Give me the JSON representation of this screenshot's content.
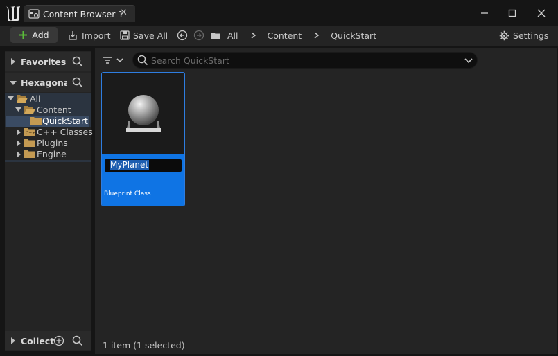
{
  "window": {
    "tab_title": "Content Browser 1",
    "tab_icon": "content-browser-icon",
    "logo_icon": "unreal-engine-logo",
    "controls": [
      "minimize-icon",
      "maximize-icon",
      "close-icon"
    ]
  },
  "toolbar": {
    "add_label": "Add",
    "import_label": "Import",
    "save_all_label": "Save All",
    "breadcrumb": [
      "All",
      "Content",
      "QuickStart"
    ],
    "settings_label": "Settings"
  },
  "sidebar": {
    "favorites_title": "Favorites",
    "project_title": "HexagonalS",
    "tree": [
      {
        "label": "All",
        "level": 0,
        "expanded": true
      },
      {
        "label": "Content",
        "level": 1,
        "expanded": true
      },
      {
        "label": "QuickStart",
        "level": 2,
        "selected": true
      },
      {
        "label": "C++ Classes",
        "level": 1,
        "expanded": false
      },
      {
        "label": "Plugins",
        "level": 1,
        "expanded": false
      },
      {
        "label": "Engine",
        "level": 1,
        "expanded": false
      }
    ],
    "collections_title": "Collect"
  },
  "search": {
    "placeholder": "Search QuickStart",
    "value": ""
  },
  "assets": [
    {
      "name": "MyPlanet",
      "type": "Blueprint Class",
      "selected": true,
      "renaming": true
    }
  ],
  "status": "1 item (1 selected)",
  "colors": {
    "accent": "#0f74e4",
    "selection_row": "#3a4b63",
    "folder": "#c49a52",
    "add_plus": "#5bbd3a"
  }
}
